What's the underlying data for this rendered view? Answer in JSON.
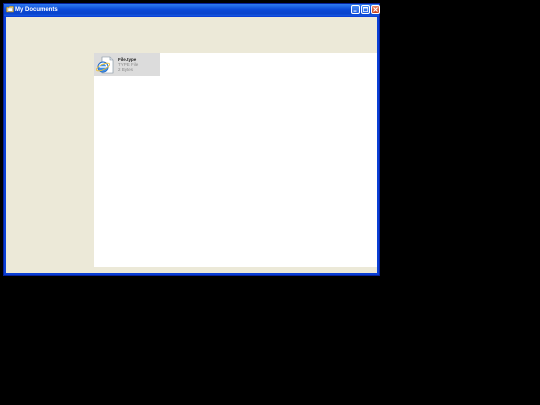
{
  "window": {
    "title": "My Documents",
    "icon": "my-documents-icon",
    "controls": {
      "minimize": "minimize-icon",
      "maximize": "maximize-icon",
      "close": "close-icon"
    }
  },
  "content": {
    "files": [
      {
        "name": "File.type",
        "type": "TYPE File",
        "size": "2 Bytes",
        "icon": "internet-explorer-icon"
      }
    ]
  },
  "colors": {
    "titlebar": "#0a43cc",
    "client_background": "#ece9d8",
    "pane_background": "#ffffff",
    "selected_item": "#dcdcdc",
    "close_button": "#c6401f"
  }
}
